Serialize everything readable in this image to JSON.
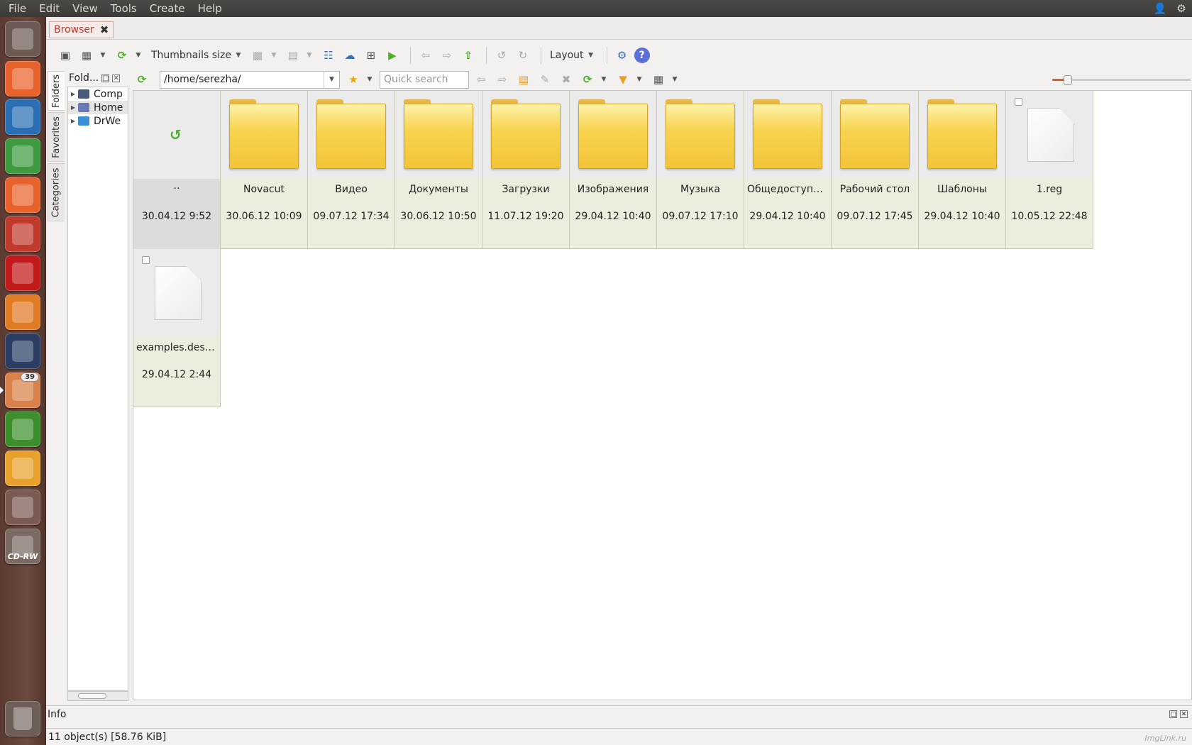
{
  "menubar": {
    "items": [
      "File",
      "Edit",
      "View",
      "Tools",
      "Create",
      "Help"
    ]
  },
  "launcher": {
    "items": [
      {
        "name": "dash-home",
        "color": "#6d5a52"
      },
      {
        "name": "files",
        "color": "#e8622c"
      },
      {
        "name": "writer",
        "color": "#2a6fb5"
      },
      {
        "name": "calc",
        "color": "#3f9b3f"
      },
      {
        "name": "software-center",
        "color": "#e8622c"
      },
      {
        "name": "system-settings",
        "color": "#c0392b"
      },
      {
        "name": "opera",
        "color": "#c21a1a"
      },
      {
        "name": "vlc",
        "color": "#e07b24"
      },
      {
        "name": "keepassx",
        "color": "#2b3d63"
      },
      {
        "name": "updates",
        "color": "#d8814a",
        "badge": "39"
      },
      {
        "name": "novacut",
        "color": "#3d8f2c"
      },
      {
        "name": "xnview",
        "color": "#e8a22c"
      },
      {
        "name": "workspaces",
        "color": "#7a5a52"
      },
      {
        "name": "cd-rw",
        "color": "#7a6a62",
        "label": "CD-RW"
      }
    ],
    "trash": {
      "name": "trash",
      "color": "#6e5e58"
    }
  },
  "tab": {
    "label": "Browser"
  },
  "toolbar": {
    "thumbnails_label": "Thumbnails size",
    "layout_label": "Layout"
  },
  "folders_panel": {
    "title": "Fold...",
    "tabs": [
      "Folders",
      "Favorites",
      "Categories"
    ],
    "tree": [
      {
        "label": "Comp",
        "color": "#4a5a7a"
      },
      {
        "label": "Home",
        "color": "#6a7ab5"
      },
      {
        "label": "DrWe",
        "color": "#3d8fd8"
      }
    ]
  },
  "navbar": {
    "path": "/home/serezha/",
    "search_placeholder": "Quick search",
    "zoom_level": 0.08
  },
  "items": [
    {
      "name": "..",
      "date": "30.04.12 9:52",
      "kind": "parent"
    },
    {
      "name": "Novacut",
      "date": "30.06.12 10:09",
      "kind": "folder"
    },
    {
      "name": "Видео",
      "date": "09.07.12 17:34",
      "kind": "folder"
    },
    {
      "name": "Документы",
      "date": "30.06.12 10:50",
      "kind": "folder"
    },
    {
      "name": "Загрузки",
      "date": "11.07.12 19:20",
      "kind": "folder"
    },
    {
      "name": "Изображения",
      "date": "29.04.12 10:40",
      "kind": "folder"
    },
    {
      "name": "Музыка",
      "date": "09.07.12 17:10",
      "kind": "folder"
    },
    {
      "name": "Общедоступные",
      "date": "29.04.12 10:40",
      "kind": "folder"
    },
    {
      "name": "Рабочий стол",
      "date": "09.07.12 17:45",
      "kind": "folder"
    },
    {
      "name": "Шаблоны",
      "date": "29.04.12 10:40",
      "kind": "folder"
    },
    {
      "name": "1.reg",
      "date": "10.05.12 22:48",
      "kind": "file"
    },
    {
      "name": "examples.desk...",
      "date": "29.04.12 2:44",
      "kind": "file"
    }
  ],
  "info": {
    "label": "Info"
  },
  "status": {
    "text": "11 object(s) [58.76 KiB]"
  },
  "watermark": "ImgLink.ru"
}
